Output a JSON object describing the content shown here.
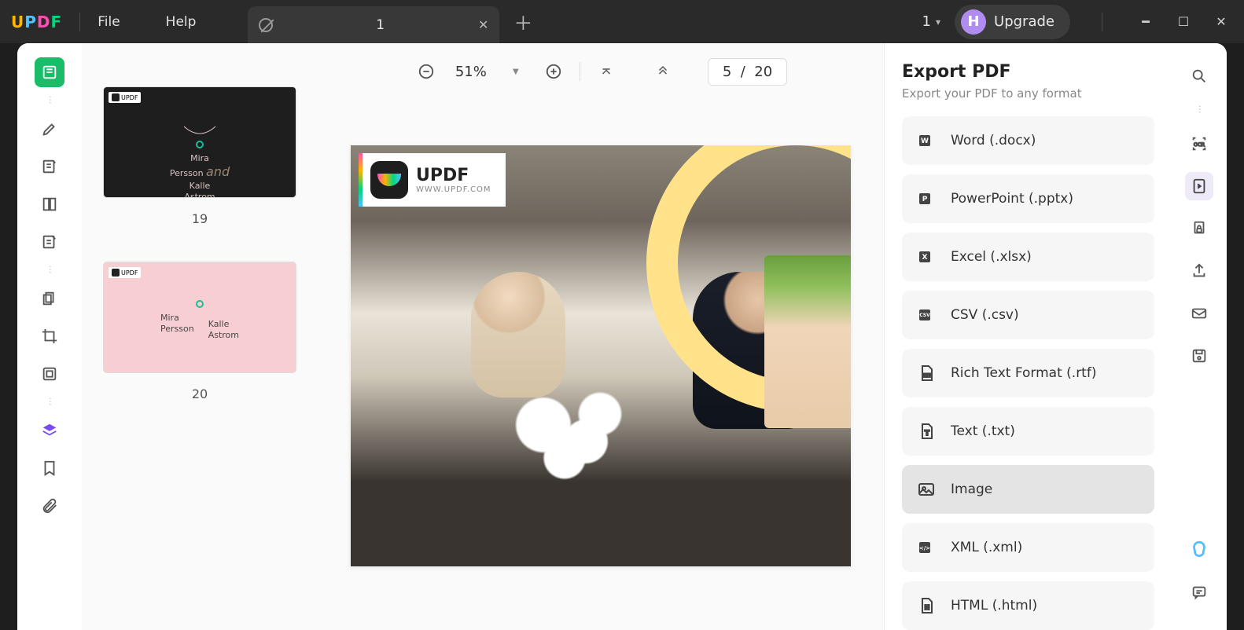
{
  "menu": {
    "file": "File",
    "help": "Help"
  },
  "tab": {
    "title": "1",
    "count": "1"
  },
  "upgrade": {
    "avatar_letter": "H",
    "label": "Upgrade"
  },
  "toolbar": {
    "zoom": "51%",
    "page_current": "5",
    "page_sep": "/",
    "page_total": "20"
  },
  "thumbnails": [
    {
      "num": "19",
      "badge": "UPDF",
      "name1a": "Mira",
      "name1b": "Persson",
      "and": "and",
      "name2a": "Kalle",
      "name2b": "Astrom"
    },
    {
      "num": "20",
      "badge": "UPDF",
      "name1a": "Mira",
      "name1b": "Persson",
      "name2a": "Kalle",
      "name2b": "Astrom"
    }
  ],
  "page_badge": {
    "title": "UPDF",
    "url": "WWW.UPDF.COM"
  },
  "export": {
    "title": "Export PDF",
    "subtitle": "Export your PDF to any format",
    "formats": [
      {
        "label": "Word (.docx)"
      },
      {
        "label": "PowerPoint (.pptx)"
      },
      {
        "label": "Excel (.xlsx)"
      },
      {
        "label": "CSV (.csv)"
      },
      {
        "label": "Rich Text Format (.rtf)"
      },
      {
        "label": "Text (.txt)"
      },
      {
        "label": "Image"
      },
      {
        "label": "XML (.xml)"
      },
      {
        "label": "HTML (.html)"
      }
    ]
  }
}
